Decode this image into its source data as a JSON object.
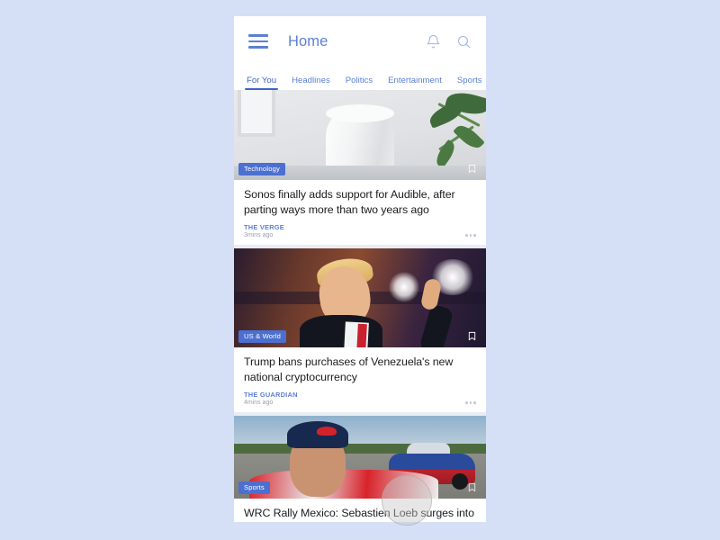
{
  "app": {
    "title": "Home",
    "menu_icon": "hamburger-icon",
    "notifications_icon": "bell-icon",
    "search_icon": "search-icon"
  },
  "tabs": [
    {
      "label": "For You",
      "active": true
    },
    {
      "label": "Headlines",
      "active": false
    },
    {
      "label": "Politics",
      "active": false
    },
    {
      "label": "Entertainment",
      "active": false
    },
    {
      "label": "Sports",
      "active": false
    }
  ],
  "colors": {
    "page_background": "#d5e0f7",
    "accent": "#5b7fd4",
    "tab_active": "#3f63c9",
    "badge": "#4c6fd0",
    "headline": "#1d1d1f",
    "timestamp": "#9aa0ab"
  },
  "feed": [
    {
      "category": "Technology",
      "headline": "Sonos finally adds support for Audible, after parting ways more than two years ago",
      "source": "THE VERGE",
      "time": "3mins ago",
      "bookmark_icon": "bookmark-icon",
      "more_icon": "overflow-menu-icon",
      "image_alt": "white smart speaker on a shelf beside a green plant"
    },
    {
      "category": "US & World",
      "headline": "Trump bans purchases of Venezuela's new national cryptocurrency",
      "source": "THE GUARDIAN",
      "time": "4mins ago",
      "bookmark_icon": "bookmark-icon",
      "more_icon": "overflow-menu-icon",
      "image_alt": "man in dark suit with red tie pointing upward under stage lights"
    },
    {
      "category": "Sports",
      "headline": "WRC Rally Mexico: Sebastien Loeb surges into overall lead",
      "source": "",
      "time": "",
      "bookmark_icon": "bookmark-icon",
      "more_icon": "overflow-menu-icon",
      "image_alt": "rally driver in a team cap with a rally car on the track behind him"
    }
  ]
}
